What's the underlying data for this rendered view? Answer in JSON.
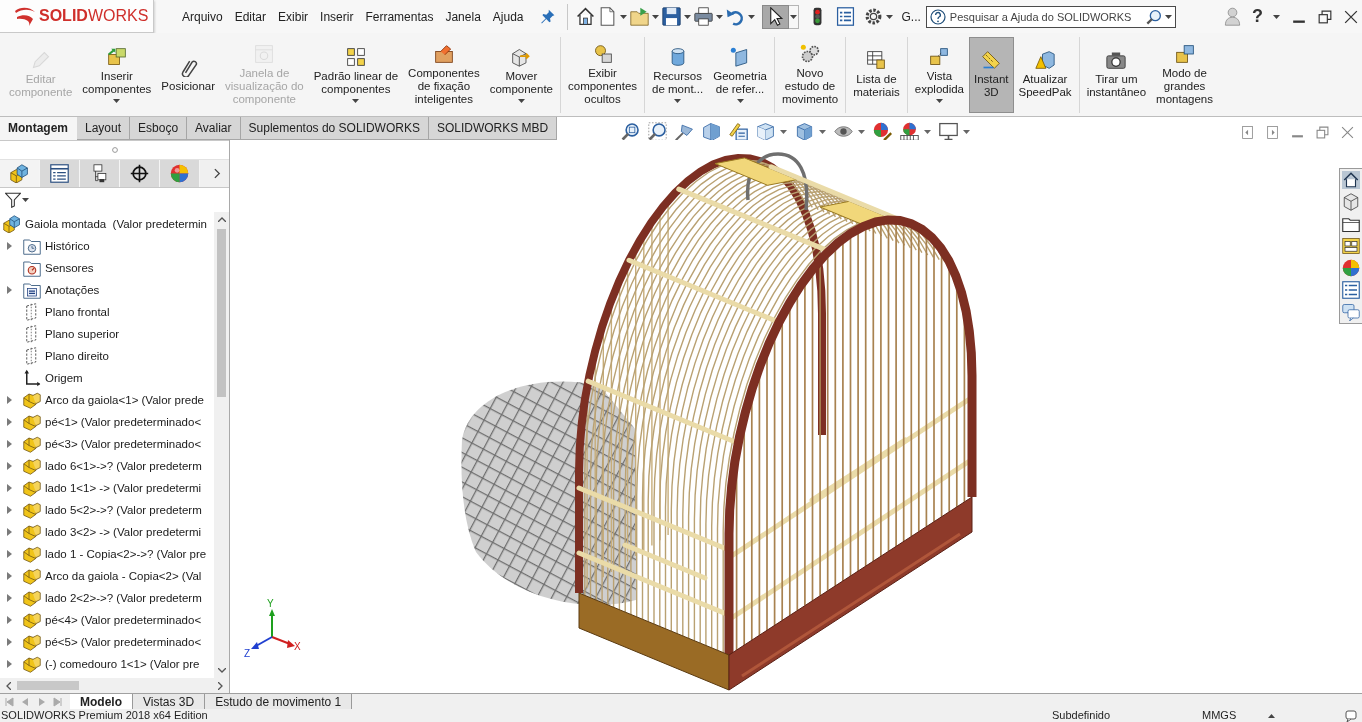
{
  "logo": {
    "wordmark": "**SOLID**WORKS"
  },
  "menu": [
    "Arquivo",
    "Editar",
    "Exibir",
    "Inserir",
    "Ferramentas",
    "Janela",
    "Ajuda"
  ],
  "select_tool": {
    "selected": true
  },
  "overflow_label": "G...",
  "search": {
    "placeholder": "Pesquisar a Ajuda do SOLIDWORKS"
  },
  "help_label": "?",
  "ribbon": {
    "groups": [
      {
        "buttons": [
          {
            "label": "Editar\ncomponente",
            "disabled": true,
            "selected": false,
            "dropdown": false
          },
          {
            "label": "Inserir\ncomponentes",
            "disabled": false,
            "selected": false,
            "dropdown": true
          },
          {
            "label": "Posicionar",
            "disabled": false,
            "selected": false,
            "dropdown": false
          },
          {
            "label": "Janela de\nvisualização do\ncomponente",
            "disabled": true,
            "selected": false,
            "dropdown": false
          },
          {
            "label": "Padrão linear de\ncomponentes",
            "disabled": false,
            "selected": false,
            "dropdown": true
          },
          {
            "label": "Componentes\nde fixação\ninteligentes",
            "disabled": false,
            "selected": false,
            "dropdown": false
          },
          {
            "label": "Mover\ncomponente",
            "disabled": false,
            "selected": false,
            "dropdown": true
          }
        ]
      },
      {
        "buttons": [
          {
            "label": "Exibir\ncomponentes\nocultos",
            "disabled": false,
            "selected": false,
            "dropdown": false
          }
        ]
      },
      {
        "buttons": [
          {
            "label": "Recursos\nde mont...",
            "disabled": false,
            "selected": false,
            "dropdown": true
          },
          {
            "label": "Geometria\nde refer...",
            "disabled": false,
            "selected": false,
            "dropdown": true
          }
        ]
      },
      {
        "buttons": [
          {
            "label": "Novo\nestudo de\nmovimento",
            "disabled": false,
            "selected": false,
            "dropdown": false
          }
        ]
      },
      {
        "buttons": [
          {
            "label": "Lista de\nmateriais",
            "disabled": false,
            "selected": false,
            "dropdown": false
          }
        ]
      },
      {
        "buttons": [
          {
            "label": "Vista\nexplodida",
            "disabled": false,
            "selected": false,
            "dropdown": true
          },
          {
            "label": "Instant\n3D",
            "disabled": false,
            "selected": true,
            "dropdown": false
          },
          {
            "label": "Atualizar\nSpeedPak",
            "disabled": false,
            "selected": false,
            "dropdown": false
          }
        ]
      },
      {
        "buttons": [
          {
            "label": "Tirar um\ninstantâneo",
            "disabled": false,
            "selected": false,
            "dropdown": false
          },
          {
            "label": "Modo de\ngrandes\nmontagens",
            "disabled": false,
            "selected": false,
            "dropdown": false
          }
        ]
      }
    ]
  },
  "command_tabs": [
    {
      "label": "Montagem",
      "selected": true
    },
    {
      "label": "Layout",
      "selected": false
    },
    {
      "label": "Esboço",
      "selected": false
    },
    {
      "label": "Avaliar",
      "selected": false
    },
    {
      "label": "Suplementos do SOLIDWORKS",
      "selected": false
    },
    {
      "label": "SOLIDWORKS MBD",
      "selected": false
    }
  ],
  "panel_tabs": [
    {
      "selected": true
    },
    {
      "selected": false
    },
    {
      "selected": false
    },
    {
      "selected": false
    },
    {
      "selected": false
    }
  ],
  "feature_tree": {
    "label": "Gaiola montada  (Valor predetermin",
    "kind": "assembly",
    "children": [
      {
        "label": "Histórico",
        "kind": "history",
        "expandable": true
      },
      {
        "label": "Sensores",
        "kind": "sensors",
        "expandable": false
      },
      {
        "label": "Anotações",
        "kind": "annotations",
        "expandable": true
      },
      {
        "label": "Plano frontal",
        "kind": "plane",
        "expandable": false
      },
      {
        "label": "Plano superior",
        "kind": "plane",
        "expandable": false
      },
      {
        "label": "Plano direito",
        "kind": "plane",
        "expandable": false
      },
      {
        "label": "Origem",
        "kind": "origin",
        "expandable": false
      },
      {
        "label": "Arco da gaiola<1> (Valor prede",
        "kind": "part",
        "expandable": true
      },
      {
        "label": "pé<1> (Valor predeterminado<",
        "kind": "part",
        "expandable": true
      },
      {
        "label": "pé<3> (Valor predeterminado<",
        "kind": "part",
        "expandable": true
      },
      {
        "label": "lado 6<1>->? (Valor predeterm",
        "kind": "part",
        "expandable": true
      },
      {
        "label": "lado 1<1> -> (Valor predetermi",
        "kind": "part",
        "expandable": true
      },
      {
        "label": "lado 5<2>->? (Valor predeterm",
        "kind": "part",
        "expandable": true
      },
      {
        "label": "lado 3<2> -> (Valor predetermi",
        "kind": "part",
        "expandable": true
      },
      {
        "label": "lado 1 - Copia<2>->? (Valor pre",
        "kind": "part",
        "expandable": true
      },
      {
        "label": "Arco da gaiola - Copia<2> (Val",
        "kind": "part",
        "expandable": true
      },
      {
        "label": "lado 2<2>->? (Valor predeterm",
        "kind": "part",
        "expandable": true
      },
      {
        "label": "pé<4> (Valor predeterminado<",
        "kind": "part",
        "expandable": true
      },
      {
        "label": "pé<5> (Valor predeterminado<",
        "kind": "part",
        "expandable": true
      },
      {
        "label": "(-) comedouro 1<1> (Valor pre",
        "kind": "part",
        "expandable": true
      }
    ]
  },
  "triad": {
    "x": "X",
    "y": "Y",
    "z": "Z"
  },
  "sheet_tabs": [
    {
      "label": "Modelo",
      "selected": true
    },
    {
      "label": "Vistas 3D",
      "selected": false
    },
    {
      "label": "Estudo de movimento 1",
      "selected": false
    }
  ],
  "status_bar": {
    "edition": "SOLIDWORKS Premium 2018 x64 Edition",
    "state": "Subdefinido",
    "units": "MMGS"
  }
}
